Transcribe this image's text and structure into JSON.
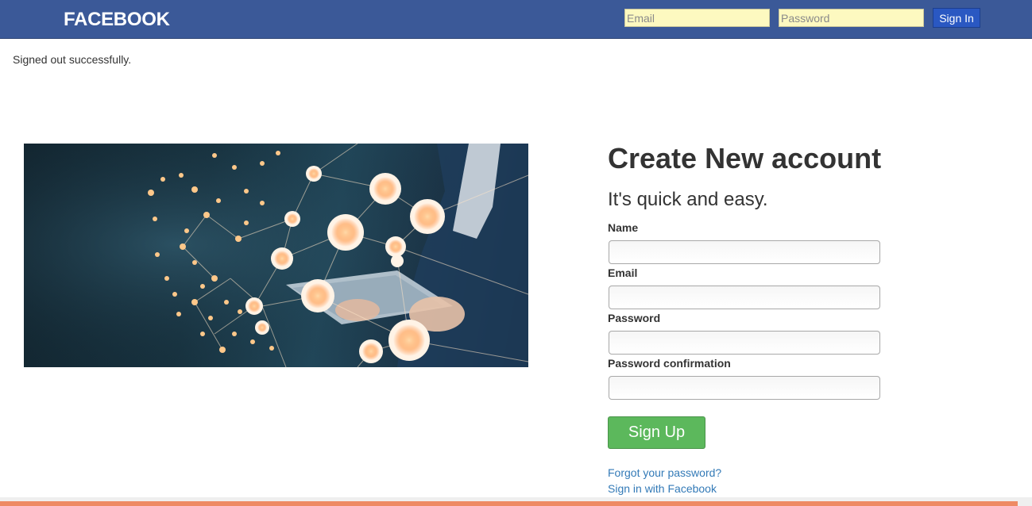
{
  "header": {
    "brand": "FACEBOOK",
    "email_placeholder": "Email",
    "password_placeholder": "Password",
    "signin_label": "Sign In"
  },
  "notice": "Signed out successfully.",
  "hero": {
    "image": "social-network-tablet-image"
  },
  "signup": {
    "title": "Create New account",
    "subtitle": "It's quick and easy.",
    "name_label": "Name",
    "email_label": "Email",
    "password_label": "Password",
    "password_confirmation_label": "Password confirmation",
    "submit_label": "Sign Up",
    "forgot_link": "Forgot your password?",
    "facebook_link": "Sign in with Facebook"
  },
  "colors": {
    "header_bg": "#3b5998",
    "signin_bg": "#2a58c2",
    "signup_btn": "#5cb85c",
    "link": "#337ab7",
    "input_bg": "#fdf9c0"
  }
}
